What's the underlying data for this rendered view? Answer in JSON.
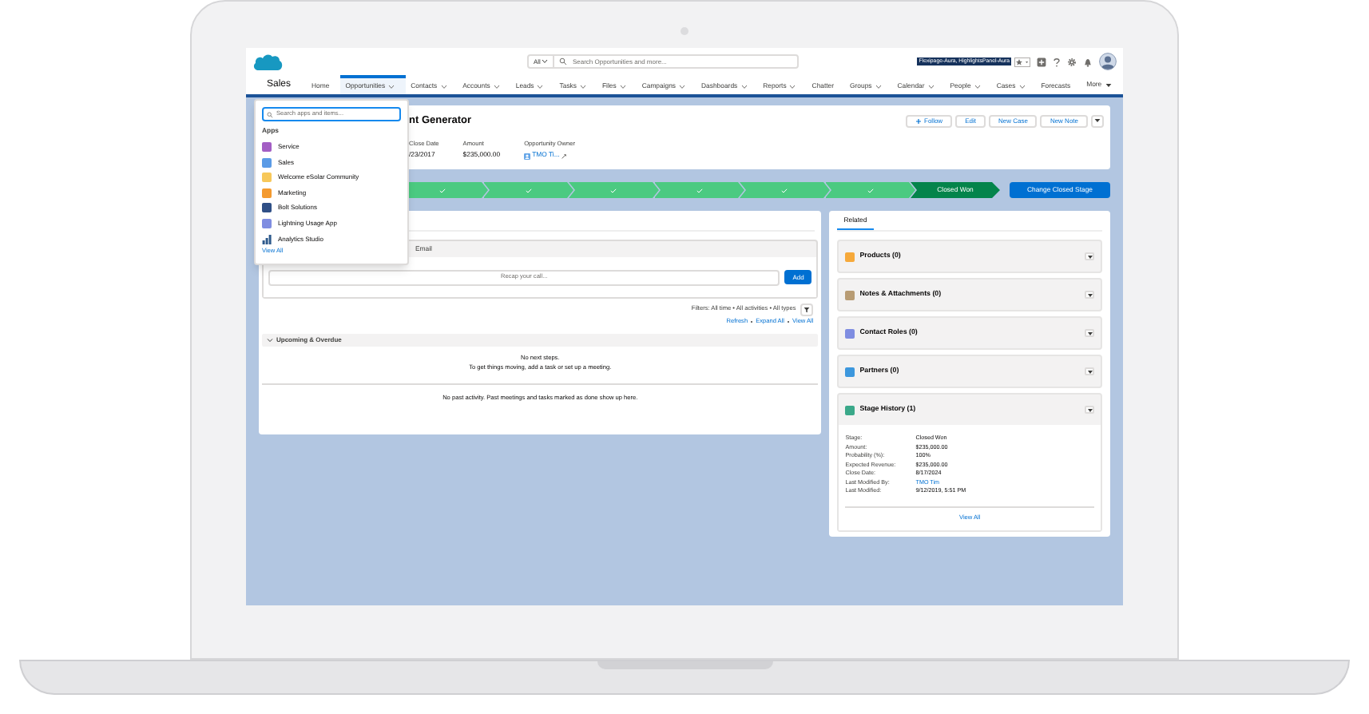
{
  "header": {
    "search_scope": "All",
    "search_placeholder": "Search Opportunities and more...",
    "debug_badge": "Flexipage-Aura, HighlightsPanel-Aura"
  },
  "nav": {
    "app_name": "Sales",
    "more": "More",
    "tabs": [
      {
        "label": "Home",
        "menu": false,
        "selected": false
      },
      {
        "label": "Opportunities",
        "menu": true,
        "selected": true
      },
      {
        "label": "Contacts",
        "menu": true,
        "selected": false
      },
      {
        "label": "Accounts",
        "menu": true,
        "selected": false
      },
      {
        "label": "Leads",
        "menu": true,
        "selected": false
      },
      {
        "label": "Tasks",
        "menu": true,
        "selected": false
      },
      {
        "label": "Files",
        "menu": true,
        "selected": false
      },
      {
        "label": "Campaigns",
        "menu": true,
        "selected": false
      },
      {
        "label": "Dashboards",
        "menu": true,
        "selected": false
      },
      {
        "label": "Reports",
        "menu": true,
        "selected": false
      },
      {
        "label": "Chatter",
        "menu": false,
        "selected": false
      },
      {
        "label": "Groups",
        "menu": true,
        "selected": false
      },
      {
        "label": "Calendar",
        "menu": true,
        "selected": false
      },
      {
        "label": "People",
        "menu": true,
        "selected": false
      },
      {
        "label": "Cases",
        "menu": true,
        "selected": false
      },
      {
        "label": "Forecasts",
        "menu": false,
        "selected": false
      }
    ]
  },
  "record": {
    "title": "nt Generator",
    "actions": [
      {
        "label": "Follow",
        "kind": "follow"
      },
      {
        "label": "Edit",
        "kind": "plain"
      },
      {
        "label": "New Case",
        "kind": "plain"
      },
      {
        "label": "New Note",
        "kind": "plain"
      }
    ],
    "fields": [
      {
        "label": "Close Date",
        "value": "/23/2017",
        "kind": "text"
      },
      {
        "label": "Amount",
        "value": "$235,000.00",
        "kind": "text"
      },
      {
        "label": "Opportunity Owner",
        "value": "TMO Ti...",
        "kind": "owner"
      }
    ]
  },
  "path": {
    "stages": [
      {
        "kind": "complete"
      },
      {
        "kind": "complete"
      },
      {
        "kind": "complete"
      },
      {
        "kind": "complete"
      },
      {
        "kind": "complete"
      },
      {
        "kind": "complete"
      },
      {
        "kind": "current",
        "label": "Closed Won"
      }
    ],
    "button": "Change Closed Stage"
  },
  "activity": {
    "tab": "Email",
    "composer_placeholder": "Recap your call...",
    "add_button": "Add",
    "filters": "Filters: All time • All activities • All types",
    "links": [
      "Refresh",
      "Expand All",
      "View All"
    ],
    "section": {
      "title": "Upcoming & Overdue",
      "expanded": true,
      "lines": [
        "No next steps.",
        "To get things moving, add a task or set up a meeting."
      ]
    },
    "past": "No past activity. Past meetings and tasks marked as done show up here."
  },
  "related": {
    "tab": "Related",
    "lists": [
      {
        "title": "Products (0)",
        "color": "#f6a93b",
        "expanded": false
      },
      {
        "title": "Notes & Attachments (0)",
        "color": "#b89c74",
        "expanded": false
      },
      {
        "title": "Contact Roles (0)",
        "color": "#7f8de1",
        "expanded": false
      },
      {
        "title": "Partners (0)",
        "color": "#3c97dd",
        "expanded": false
      },
      {
        "title": "Stage History (1)",
        "color": "#3aa889",
        "expanded": true,
        "fields": [
          {
            "label": "Stage:",
            "value": "Closed Won",
            "kind": "text"
          },
          {
            "label": "Amount:",
            "value": "$235,000.00",
            "kind": "text"
          },
          {
            "label": "Probability (%):",
            "value": "100%",
            "kind": "text"
          },
          {
            "label": "Expected Revenue:",
            "value": "$235,000.00",
            "kind": "text"
          },
          {
            "label": "Close Date:",
            "value": "8/17/2024",
            "kind": "text"
          },
          {
            "label": "Last Modified By:",
            "value": "TMO Tim",
            "kind": "link"
          },
          {
            "label": "Last Modified:",
            "value": "9/12/2019, 5:51 PM",
            "kind": "text"
          }
        ],
        "view_all": "View All"
      }
    ]
  },
  "launcher": {
    "search_placeholder": "Search apps and items...",
    "heading": "Apps",
    "view_all": "View All",
    "apps": [
      {
        "label": "Service",
        "color": "#a35ec4",
        "kind": "tile"
      },
      {
        "label": "Sales",
        "color": "#5b9be6",
        "kind": "tile"
      },
      {
        "label": "Welcome eSolar Community",
        "color": "#f7c85a",
        "kind": "tile"
      },
      {
        "label": "Marketing",
        "color": "#f49a2f",
        "kind": "tile"
      },
      {
        "label": "Bolt Solutions",
        "color": "#2f4f86",
        "kind": "tile"
      },
      {
        "label": "Lightning Usage App",
        "color": "#7f8de1",
        "kind": "tile"
      },
      {
        "label": "Analytics Studio",
        "color": "#2e5a8c",
        "kind": "chart"
      }
    ]
  }
}
